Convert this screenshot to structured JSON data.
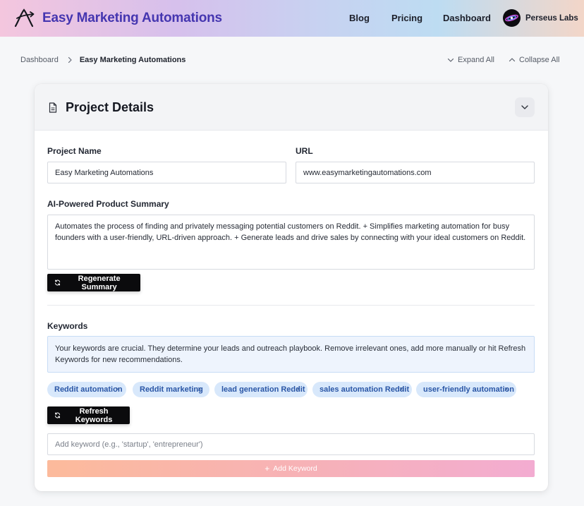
{
  "header": {
    "brand_title": "Easy Marketing Automations",
    "nav": [
      "Blog",
      "Pricing",
      "Dashboard"
    ],
    "org_name": "Perseus Labs"
  },
  "breadcrumb": {
    "items": [
      "Dashboard",
      "Easy Marketing Automations"
    ],
    "expand_all": "Expand All",
    "collapse_all": "Collapse All"
  },
  "project": {
    "section_title": "Project Details",
    "name_label": "Project Name",
    "name_value": "Easy Marketing Automations",
    "url_label": "URL",
    "url_value": "www.easymarketingautomations.com",
    "summary_label": "AI-Powered Product Summary",
    "summary_value": "Automates the process of finding and privately messaging potential customers on Reddit. + Simplifies marketing automation for busy founders with a user-friendly, URL-driven approach. + Generate leads and drive sales by connecting with your ideal customers on Reddit.",
    "regenerate_label": "Regenerate Summary"
  },
  "keywords": {
    "label": "Keywords",
    "info": "Your keywords are crucial. They determine your leads and outreach playbook. Remove irrelevant ones, add more manually or hit Refresh Keywords for new recommendations.",
    "chips": [
      "Reddit automation",
      "Reddit marketing",
      "lead generation Reddit",
      "sales automation Reddit",
      "user-friendly automation"
    ],
    "remove_glyph": "×",
    "refresh_label": "Refresh Keywords",
    "input_placeholder": "Add keyword (e.g., 'startup', 'entrepreneur')",
    "add_label": "Add Keyword"
  },
  "colors": {
    "brand": "#4536b0",
    "chip_bg": "#d8e8fb",
    "chip_text": "#2a56a6",
    "dark_button": "#0b0b0d",
    "info_bg": "#eef4fd"
  },
  "icons": {
    "brand": "arrow-a-logo-icon",
    "org": "galaxy-avatar-icon",
    "breadcrumb_separator": "chevron-right-icon",
    "expand": "chevron-down-icon",
    "collapse": "chevron-up-icon",
    "section": "document-icon",
    "regenerate": "refresh-icon",
    "refresh": "refresh-icon",
    "add": "plus-icon"
  }
}
